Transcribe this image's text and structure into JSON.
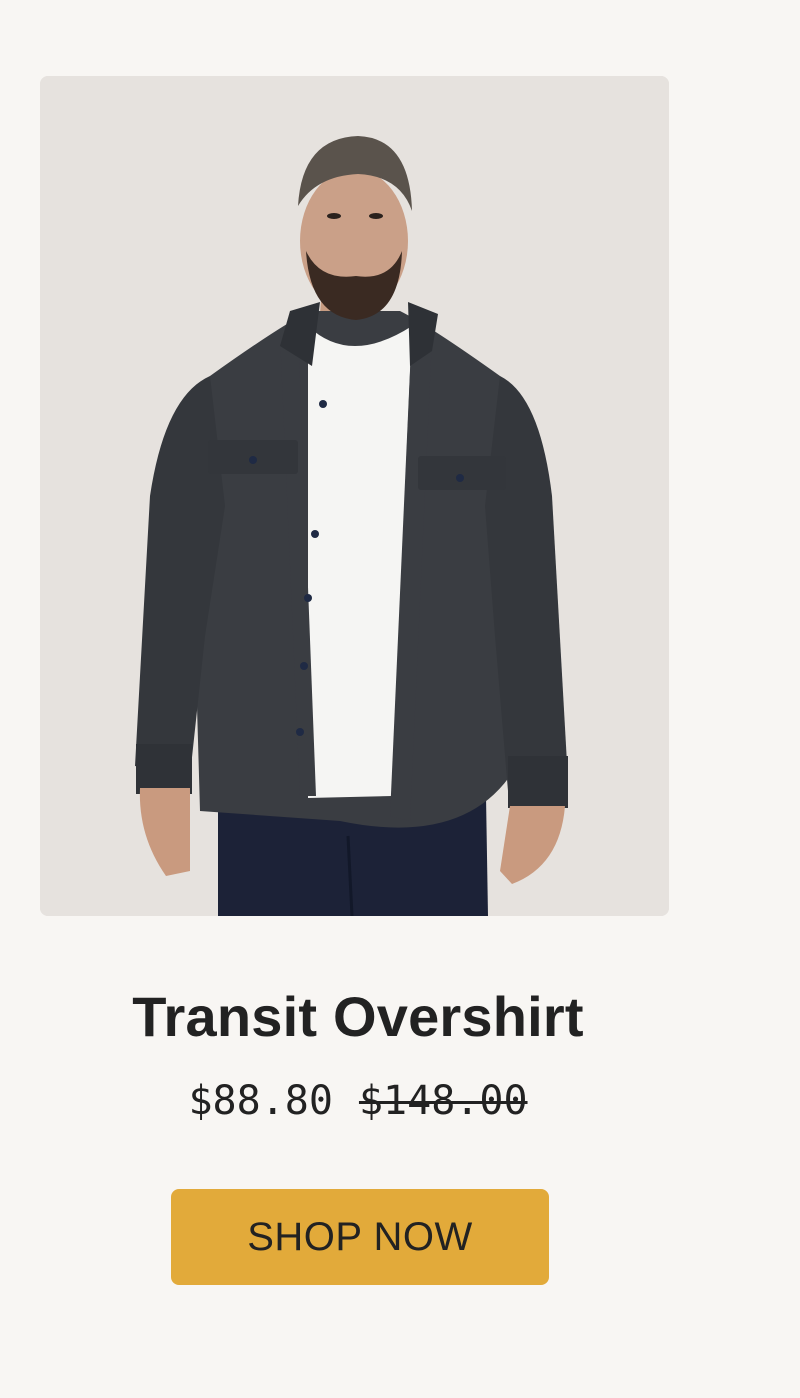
{
  "product": {
    "name": "Transit Overshirt",
    "sale_price": "$88.80",
    "original_price": "$148.00",
    "image_alt_icon": "product-photo-model-overshirt"
  },
  "cta": {
    "label": "SHOP NOW"
  },
  "colors": {
    "page_background": "#f8f6f3",
    "photo_background": "#e6e2de",
    "cta_background": "#e2aa3a",
    "text": "#222222",
    "shirt": "#3a3d42",
    "tee": "#f5f5f3",
    "pants": "#1c2237"
  }
}
